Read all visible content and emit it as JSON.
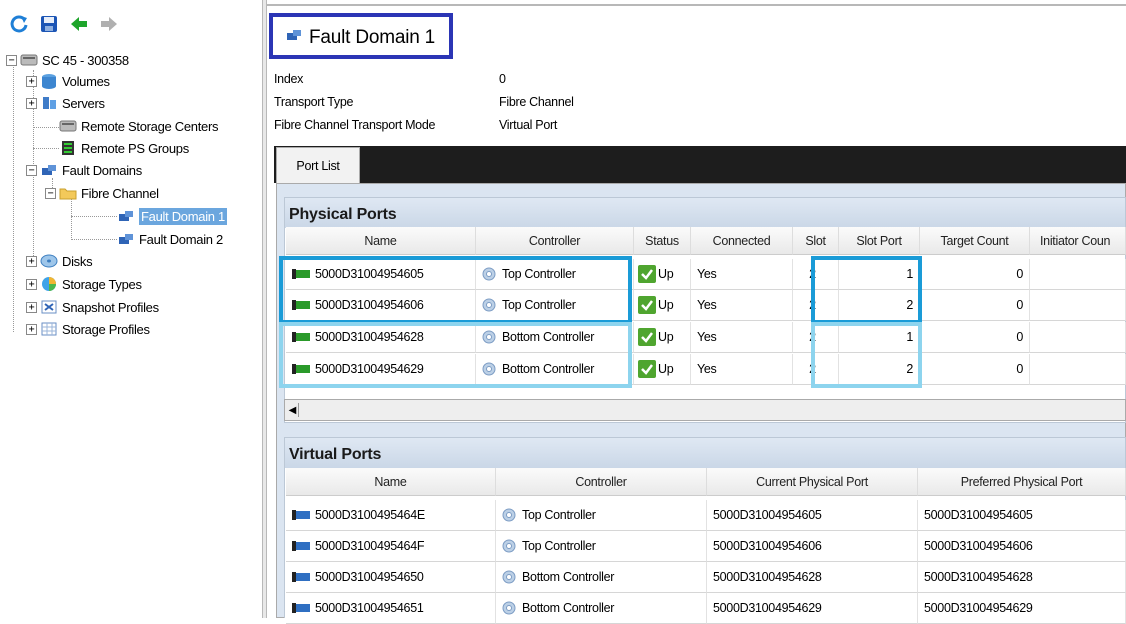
{
  "toolbar": {
    "icons": [
      "refresh-icon",
      "save-icon",
      "back-arrow-icon",
      "forward-arrow-icon"
    ]
  },
  "tree": {
    "root": "SC 45 - 300358",
    "items": {
      "volumes": "Volumes",
      "servers": "Servers",
      "remote_storage_centers": "Remote Storage Centers",
      "remote_ps_groups": "Remote PS Groups",
      "fault_domains": "Fault Domains",
      "fibre_channel": "Fibre Channel",
      "fault_domain_1": "Fault Domain 1",
      "fault_domain_2": "Fault Domain 2",
      "disks": "Disks",
      "storage_types": "Storage Types",
      "snapshot_profiles": "Snapshot Profiles",
      "storage_profiles": "Storage Profiles"
    }
  },
  "page": {
    "title": "Fault Domain 1",
    "properties": [
      {
        "key": "Index",
        "value": "0"
      },
      {
        "key": "Transport Type",
        "value": "Fibre Channel"
      },
      {
        "key": "Fibre Channel Transport Mode",
        "value": "Virtual Port"
      }
    ],
    "tab": "Port List"
  },
  "physical_ports": {
    "title": "Physical Ports",
    "headers": [
      "Name",
      "Controller",
      "Status",
      "Connected",
      "Slot",
      "Slot Port",
      "Target Count",
      "Initiator Coun"
    ],
    "rows": [
      {
        "name": "5000D31004954605",
        "controller": "Top Controller",
        "status": "Up",
        "connected": "Yes",
        "slot": "2",
        "slot_port": "1",
        "target_count": "0"
      },
      {
        "name": "5000D31004954606",
        "controller": "Top Controller",
        "status": "Up",
        "connected": "Yes",
        "slot": "2",
        "slot_port": "2",
        "target_count": "0"
      },
      {
        "name": "5000D31004954628",
        "controller": "Bottom Controller",
        "status": "Up",
        "connected": "Yes",
        "slot": "2",
        "slot_port": "1",
        "target_count": "0"
      },
      {
        "name": "5000D31004954629",
        "controller": "Bottom Controller",
        "status": "Up",
        "connected": "Yes",
        "slot": "2",
        "slot_port": "2",
        "target_count": "0"
      }
    ]
  },
  "virtual_ports": {
    "title": "Virtual Ports",
    "headers": [
      "Name",
      "Controller",
      "Current Physical Port",
      "Preferred Physical Port"
    ],
    "rows": [
      {
        "name": "5000D3100495464E",
        "controller": "Top Controller",
        "current": "5000D31004954605",
        "preferred": "5000D31004954605"
      },
      {
        "name": "5000D3100495464F",
        "controller": "Top Controller",
        "current": "5000D31004954606",
        "preferred": "5000D31004954606"
      },
      {
        "name": "5000D31004954650",
        "controller": "Bottom Controller",
        "current": "5000D31004954628",
        "preferred": "5000D31004954628"
      },
      {
        "name": "5000D31004954651",
        "controller": "Bottom Controller",
        "current": "5000D31004954629",
        "preferred": "5000D31004954629"
      }
    ]
  },
  "colors": {
    "title_highlight": "#2b35b5",
    "top_highlight": "#1a9bd7",
    "bottom_highlight": "#8dd4ee",
    "selection": "#6ba6de"
  }
}
